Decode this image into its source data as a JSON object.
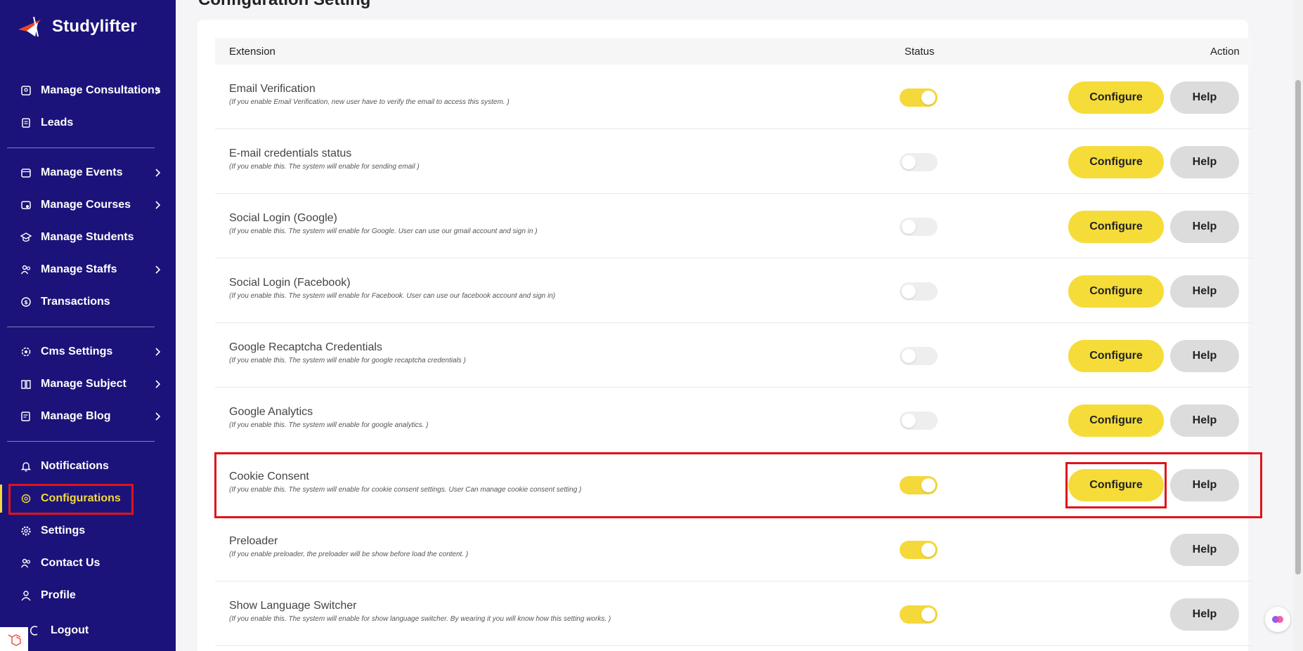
{
  "app": {
    "name": "Studylifter"
  },
  "sidebar": {
    "items": [
      {
        "label": "Manage Consultations",
        "icon": "calendar-person-icon"
      },
      {
        "label": "Leads",
        "icon": "document-icon"
      },
      {
        "label": "Manage Events",
        "icon": "calendar-icon"
      },
      {
        "label": "Manage Courses",
        "icon": "courses-icon"
      },
      {
        "label": "Manage Students",
        "icon": "students-icon"
      },
      {
        "label": "Manage Staffs",
        "icon": "staff-icon"
      },
      {
        "label": "Transactions",
        "icon": "transactions-icon"
      },
      {
        "label": "Cms Settings",
        "icon": "cms-icon"
      },
      {
        "label": "Manage Subject",
        "icon": "book-icon"
      },
      {
        "label": "Manage Blog",
        "icon": "blog-icon"
      },
      {
        "label": "Notifications",
        "icon": "bell-icon"
      },
      {
        "label": "Configurations",
        "icon": "config-icon"
      },
      {
        "label": "Settings",
        "icon": "gear-icon"
      },
      {
        "label": "Contact Us",
        "icon": "contact-icon"
      },
      {
        "label": "Profile",
        "icon": "user-icon"
      },
      {
        "label": "Logout",
        "icon": "logout-icon"
      }
    ],
    "active_item": "Configurations"
  },
  "page": {
    "title": "Configuration Setting"
  },
  "table": {
    "headers": {
      "extension": "Extension",
      "status": "Status",
      "action": "Action"
    },
    "configure_label": "Configure",
    "help_label": "Help",
    "rows": [
      {
        "name": "Email Verification",
        "desc": "(If you enable Email Verification, new user have to verify the email to access this system. )",
        "enabled": true,
        "configurable": true
      },
      {
        "name": "E-mail credentials status",
        "desc": "(If you enable this. The system will enable for sending email )",
        "enabled": false,
        "configurable": true
      },
      {
        "name": "Social Login (Google)",
        "desc": "(If you enable this. The system will enable for Google. User can use our gmail account and sign in )",
        "enabled": false,
        "configurable": true
      },
      {
        "name": "Social Login (Facebook)",
        "desc": "(If you enable this. The system will enable for Facebook. User can use our facebook account and sign in)",
        "enabled": false,
        "configurable": true
      },
      {
        "name": "Google Recaptcha Credentials",
        "desc": "(If you enable this. The system will enable for google recaptcha credentials )",
        "enabled": false,
        "configurable": true
      },
      {
        "name": "Google Analytics",
        "desc": "(If you enable this. The system will enable for google analytics. )",
        "enabled": false,
        "configurable": true
      },
      {
        "name": "Cookie Consent",
        "desc": "(If you enable this. The system will enable for cookie consent settings. User Can manage cookie consent setting )",
        "enabled": true,
        "configurable": true
      },
      {
        "name": "Preloader",
        "desc": "(If you enable preloader, the preloader will be show before load the content. )",
        "enabled": true,
        "configurable": false
      },
      {
        "name": "Show Language Switcher",
        "desc": "(If you enable this. The system will enable for show language switcher. By wearing it you will know how this setting works. )",
        "enabled": true,
        "configurable": false
      }
    ]
  },
  "colors": {
    "sidebar_bg": "#1b137a",
    "accent": "#f5d83a",
    "highlight": "#e0131b"
  }
}
